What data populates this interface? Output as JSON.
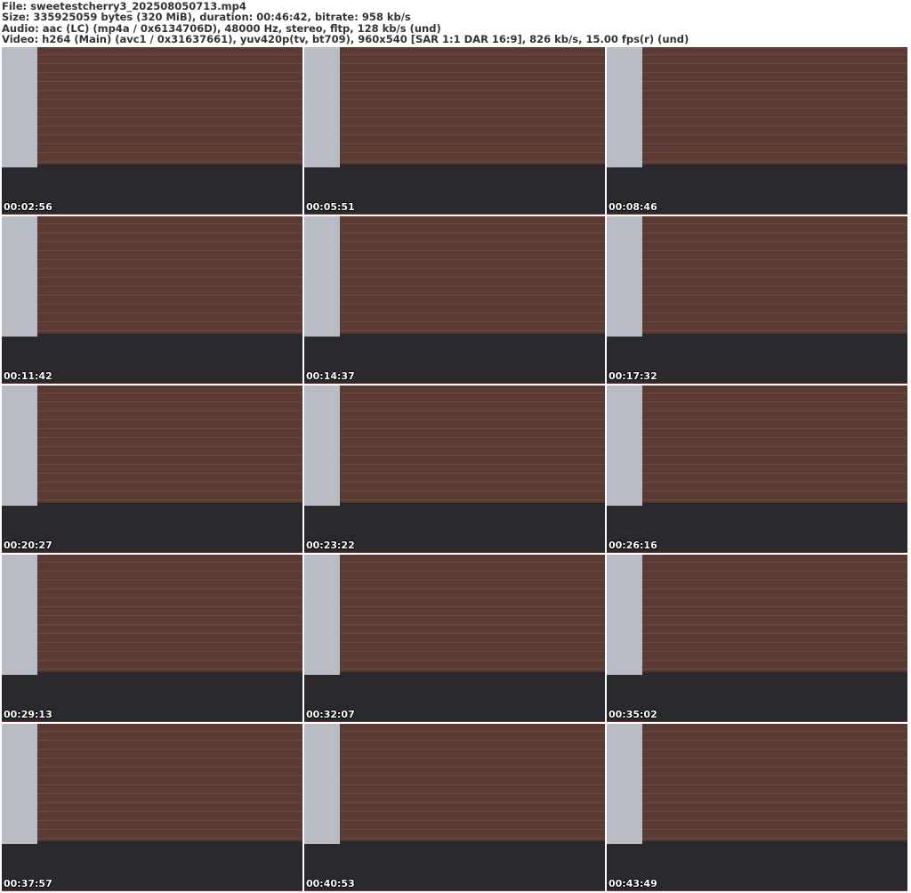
{
  "header": {
    "file": "File: sweetestcherry3_202508050713.mp4",
    "size": "Size: 335925059 bytes (320 MiB), duration: 00:46:42, bitrate: 958 kb/s",
    "audio": "Audio: aac (LC) (mp4a / 0x6134706D), 48000 Hz, stereo, fltp, 128 kb/s (und)",
    "video": "Video: h264 (Main) (avc1 / 0x31637661), yuv420p(tv, bt709), 960x540 [SAR 1:1 DAR 16:9], 826 kb/s, 15.00 fps(r) (und)"
  },
  "thumbnails": [
    {
      "time": "00:02:56"
    },
    {
      "time": "00:05:51"
    },
    {
      "time": "00:08:46"
    },
    {
      "time": "00:11:42"
    },
    {
      "time": "00:14:37"
    },
    {
      "time": "00:17:32"
    },
    {
      "time": "00:20:27"
    },
    {
      "time": "00:23:22"
    },
    {
      "time": "00:26:16"
    },
    {
      "time": "00:29:13"
    },
    {
      "time": "00:32:07"
    },
    {
      "time": "00:35:02"
    },
    {
      "time": "00:37:57"
    },
    {
      "time": "00:40:53"
    },
    {
      "time": "00:43:49"
    }
  ]
}
